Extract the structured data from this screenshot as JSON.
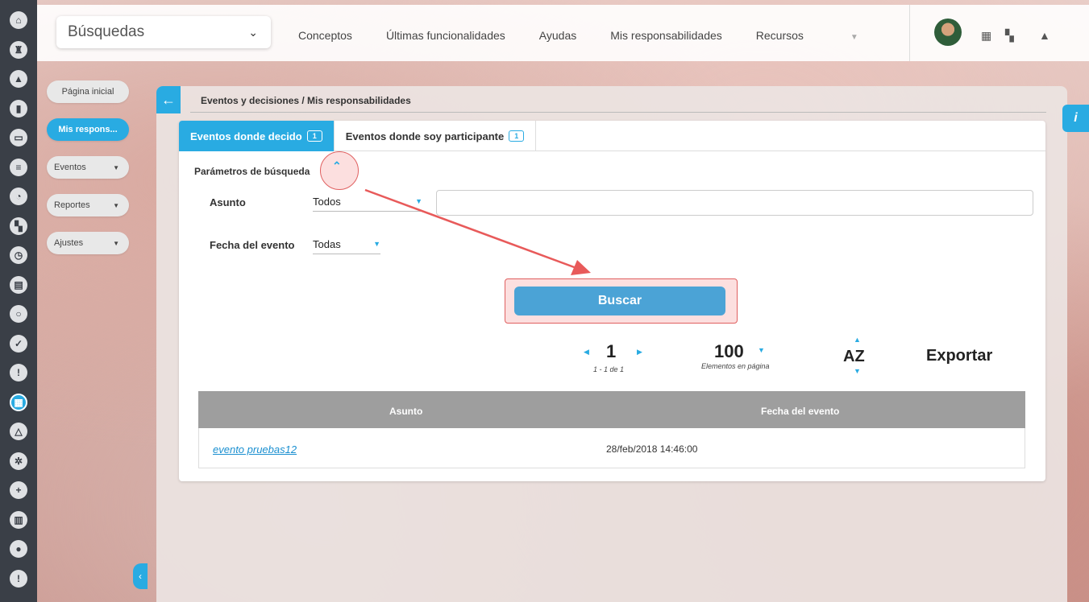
{
  "app": {
    "search_select_value": "Búsquedas"
  },
  "topnav": {
    "items": [
      "Conceptos",
      "Últimas funcionalidades",
      "Ayudas",
      "Mis responsabilidades",
      "Recursos"
    ]
  },
  "left_menu": {
    "items": [
      {
        "label": "Página inicial"
      },
      {
        "label": "Mis respons..."
      },
      {
        "label": "Eventos"
      },
      {
        "label": "Reportes"
      },
      {
        "label": "Ajustes"
      }
    ]
  },
  "breadcrumb": "Eventos y decisiones / Mis responsabilidades",
  "tabs": [
    {
      "label": "Eventos donde decido",
      "count": "1"
    },
    {
      "label": "Eventos donde soy participante",
      "count": "1"
    }
  ],
  "params": {
    "title": "Parámetros de búsqueda",
    "asunto_label": "Asunto",
    "asunto_value": "Todos",
    "fecha_label": "Fecha del evento",
    "fecha_value": "Todas",
    "search_text": ""
  },
  "buscar_label": "Buscar",
  "pager": {
    "page": "1",
    "range": "1 - 1 de 1",
    "per_page": "100",
    "per_page_label": "Elementos en página",
    "sort_label": "AZ",
    "export_label": "Exportar"
  },
  "table": {
    "headers": [
      "Asunto",
      "Fecha del evento"
    ],
    "rows": [
      {
        "asunto": "evento pruebas12",
        "fecha": "28/feb/2018 14:46:00"
      }
    ]
  },
  "colors": {
    "accent": "#29abe2",
    "highlight": "#e06060",
    "button": "#4ba3d6"
  }
}
